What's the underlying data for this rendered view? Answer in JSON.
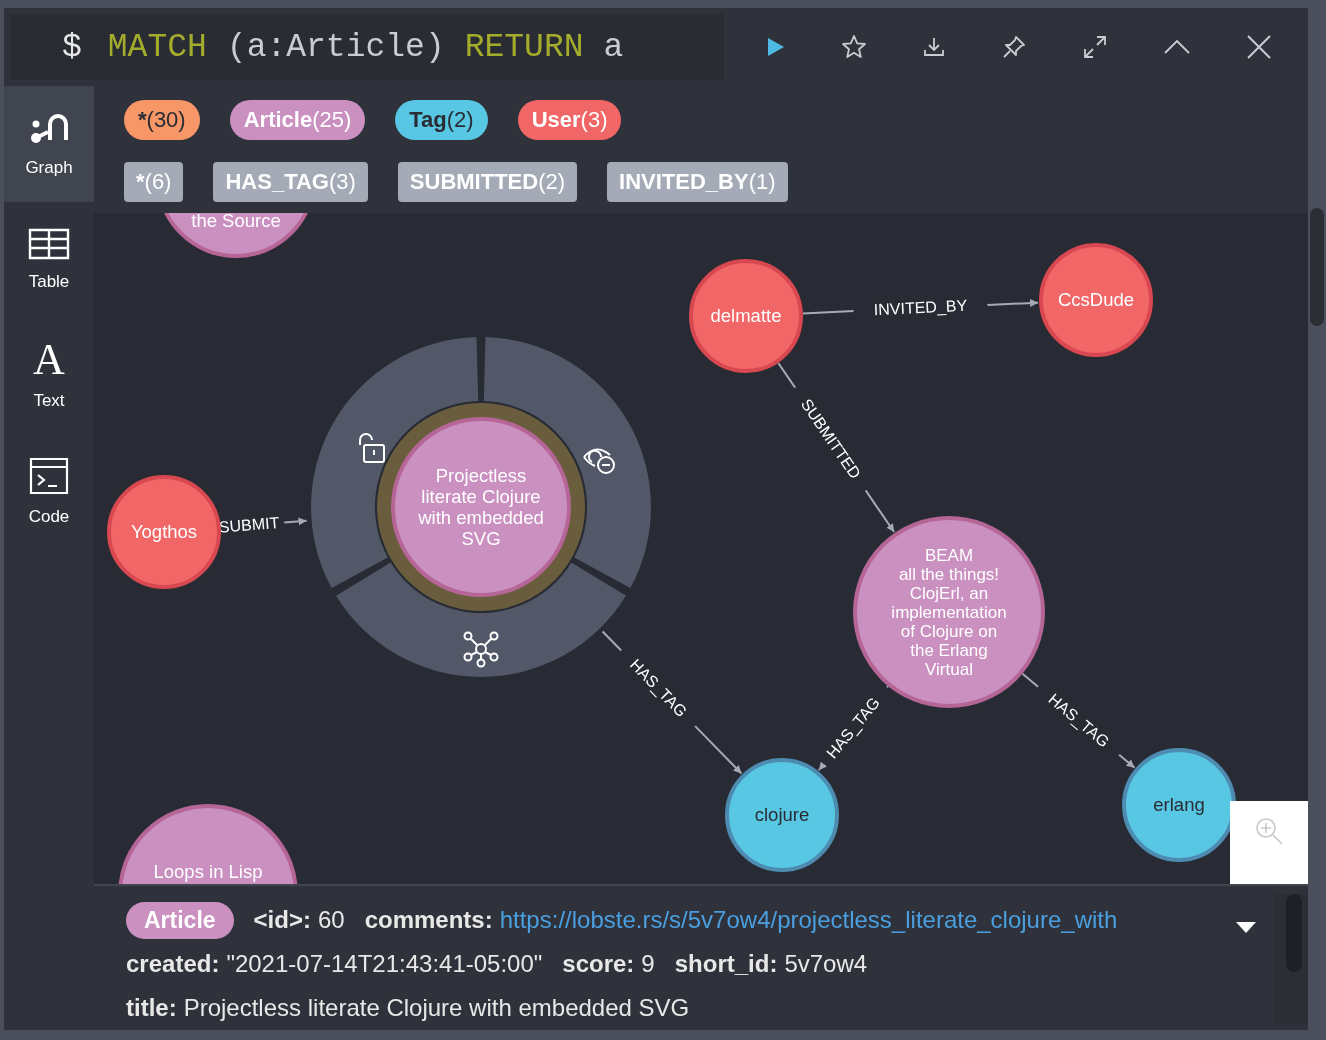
{
  "editor": {
    "prompt": "$",
    "query": [
      {
        "text": "MATCH",
        "kind": "keyword"
      },
      {
        "text": "(a:Article)",
        "kind": "plain"
      },
      {
        "text": "RETURN",
        "kind": "keyword"
      },
      {
        "text": "a",
        "kind": "plain"
      }
    ]
  },
  "sidebar": {
    "items": [
      {
        "label": "Graph",
        "selected": true
      },
      {
        "label": "Table",
        "selected": false
      },
      {
        "label": "Text",
        "glyph": "A",
        "selected": false
      },
      {
        "label": "Code",
        "selected": false
      }
    ]
  },
  "legend": {
    "node_labels": [
      {
        "name": "*",
        "count": "(30)",
        "color": "#f79767"
      },
      {
        "name": "Article",
        "count": "(25)",
        "color": "#c990c0"
      },
      {
        "name": "Tag",
        "count": "(2)",
        "color": "#57c7e3"
      },
      {
        "name": "User",
        "count": "(3)",
        "color": "#f16667"
      }
    ],
    "relationship_types": [
      {
        "name": "*",
        "count": "(6)"
      },
      {
        "name": "HAS_TAG",
        "count": "(3)"
      },
      {
        "name": "SUBMITTED",
        "count": "(2)"
      },
      {
        "name": "INVITED_BY",
        "count": "(1)"
      }
    ]
  },
  "graph": {
    "nodes": [
      {
        "caption": [
          "the Source"
        ],
        "color": "#c990c0",
        "selected": false
      },
      {
        "caption": [
          "Yogthos"
        ],
        "color": "#f16667",
        "selected": false
      },
      {
        "caption": [
          "Projectless",
          "literate Clojure",
          "with embedded",
          "SVG"
        ],
        "color": "#c990c0",
        "selected": true
      },
      {
        "caption": [
          "delmatte"
        ],
        "color": "#f16667",
        "selected": false
      },
      {
        "caption": [
          "CcsDude"
        ],
        "color": "#f16667",
        "selected": false
      },
      {
        "caption": [
          "BEAM",
          "all the things!",
          "ClojErl, an",
          "implementation",
          "of Clojure on",
          "the Erlang",
          "Virtual"
        ],
        "color": "#c990c0",
        "selected": false
      },
      {
        "caption": [
          "clojure"
        ],
        "color": "#57c7e3",
        "selected": false
      },
      {
        "caption": [
          "erlang"
        ],
        "color": "#57c7e3",
        "selected": false
      },
      {
        "caption": [
          "Loops in Lisp"
        ],
        "color": "#c990c0",
        "selected": false
      }
    ],
    "relationships": [
      {
        "label": "SUBMIT"
      },
      {
        "label": "HAS_TAG"
      },
      {
        "label": "INVITED_BY"
      },
      {
        "label": "SUBMITTED"
      },
      {
        "label": "HAS_TAG"
      },
      {
        "label": "HAS_TAG"
      }
    ]
  },
  "details": {
    "label": {
      "name": "Article",
      "color": "#c990c0"
    },
    "rows": [
      [
        {
          "key": "<id>:",
          "value": "60",
          "kind": "text"
        },
        {
          "key": "comments:",
          "value": "https://lobste.rs/s/5v7ow4/projectless_literate_clojure_with",
          "kind": "link"
        }
      ],
      [
        {
          "key": "created:",
          "value": "\"2021-07-14T21:43:41-05:00\"",
          "kind": "text"
        },
        {
          "key": "score:",
          "value": "9",
          "kind": "text"
        },
        {
          "key": "short_id:",
          "value": "5v7ow4",
          "kind": "text"
        }
      ],
      [
        {
          "key": "title:",
          "value": "Projectless literate Clojure with embedded SVG",
          "kind": "text"
        }
      ]
    ]
  }
}
